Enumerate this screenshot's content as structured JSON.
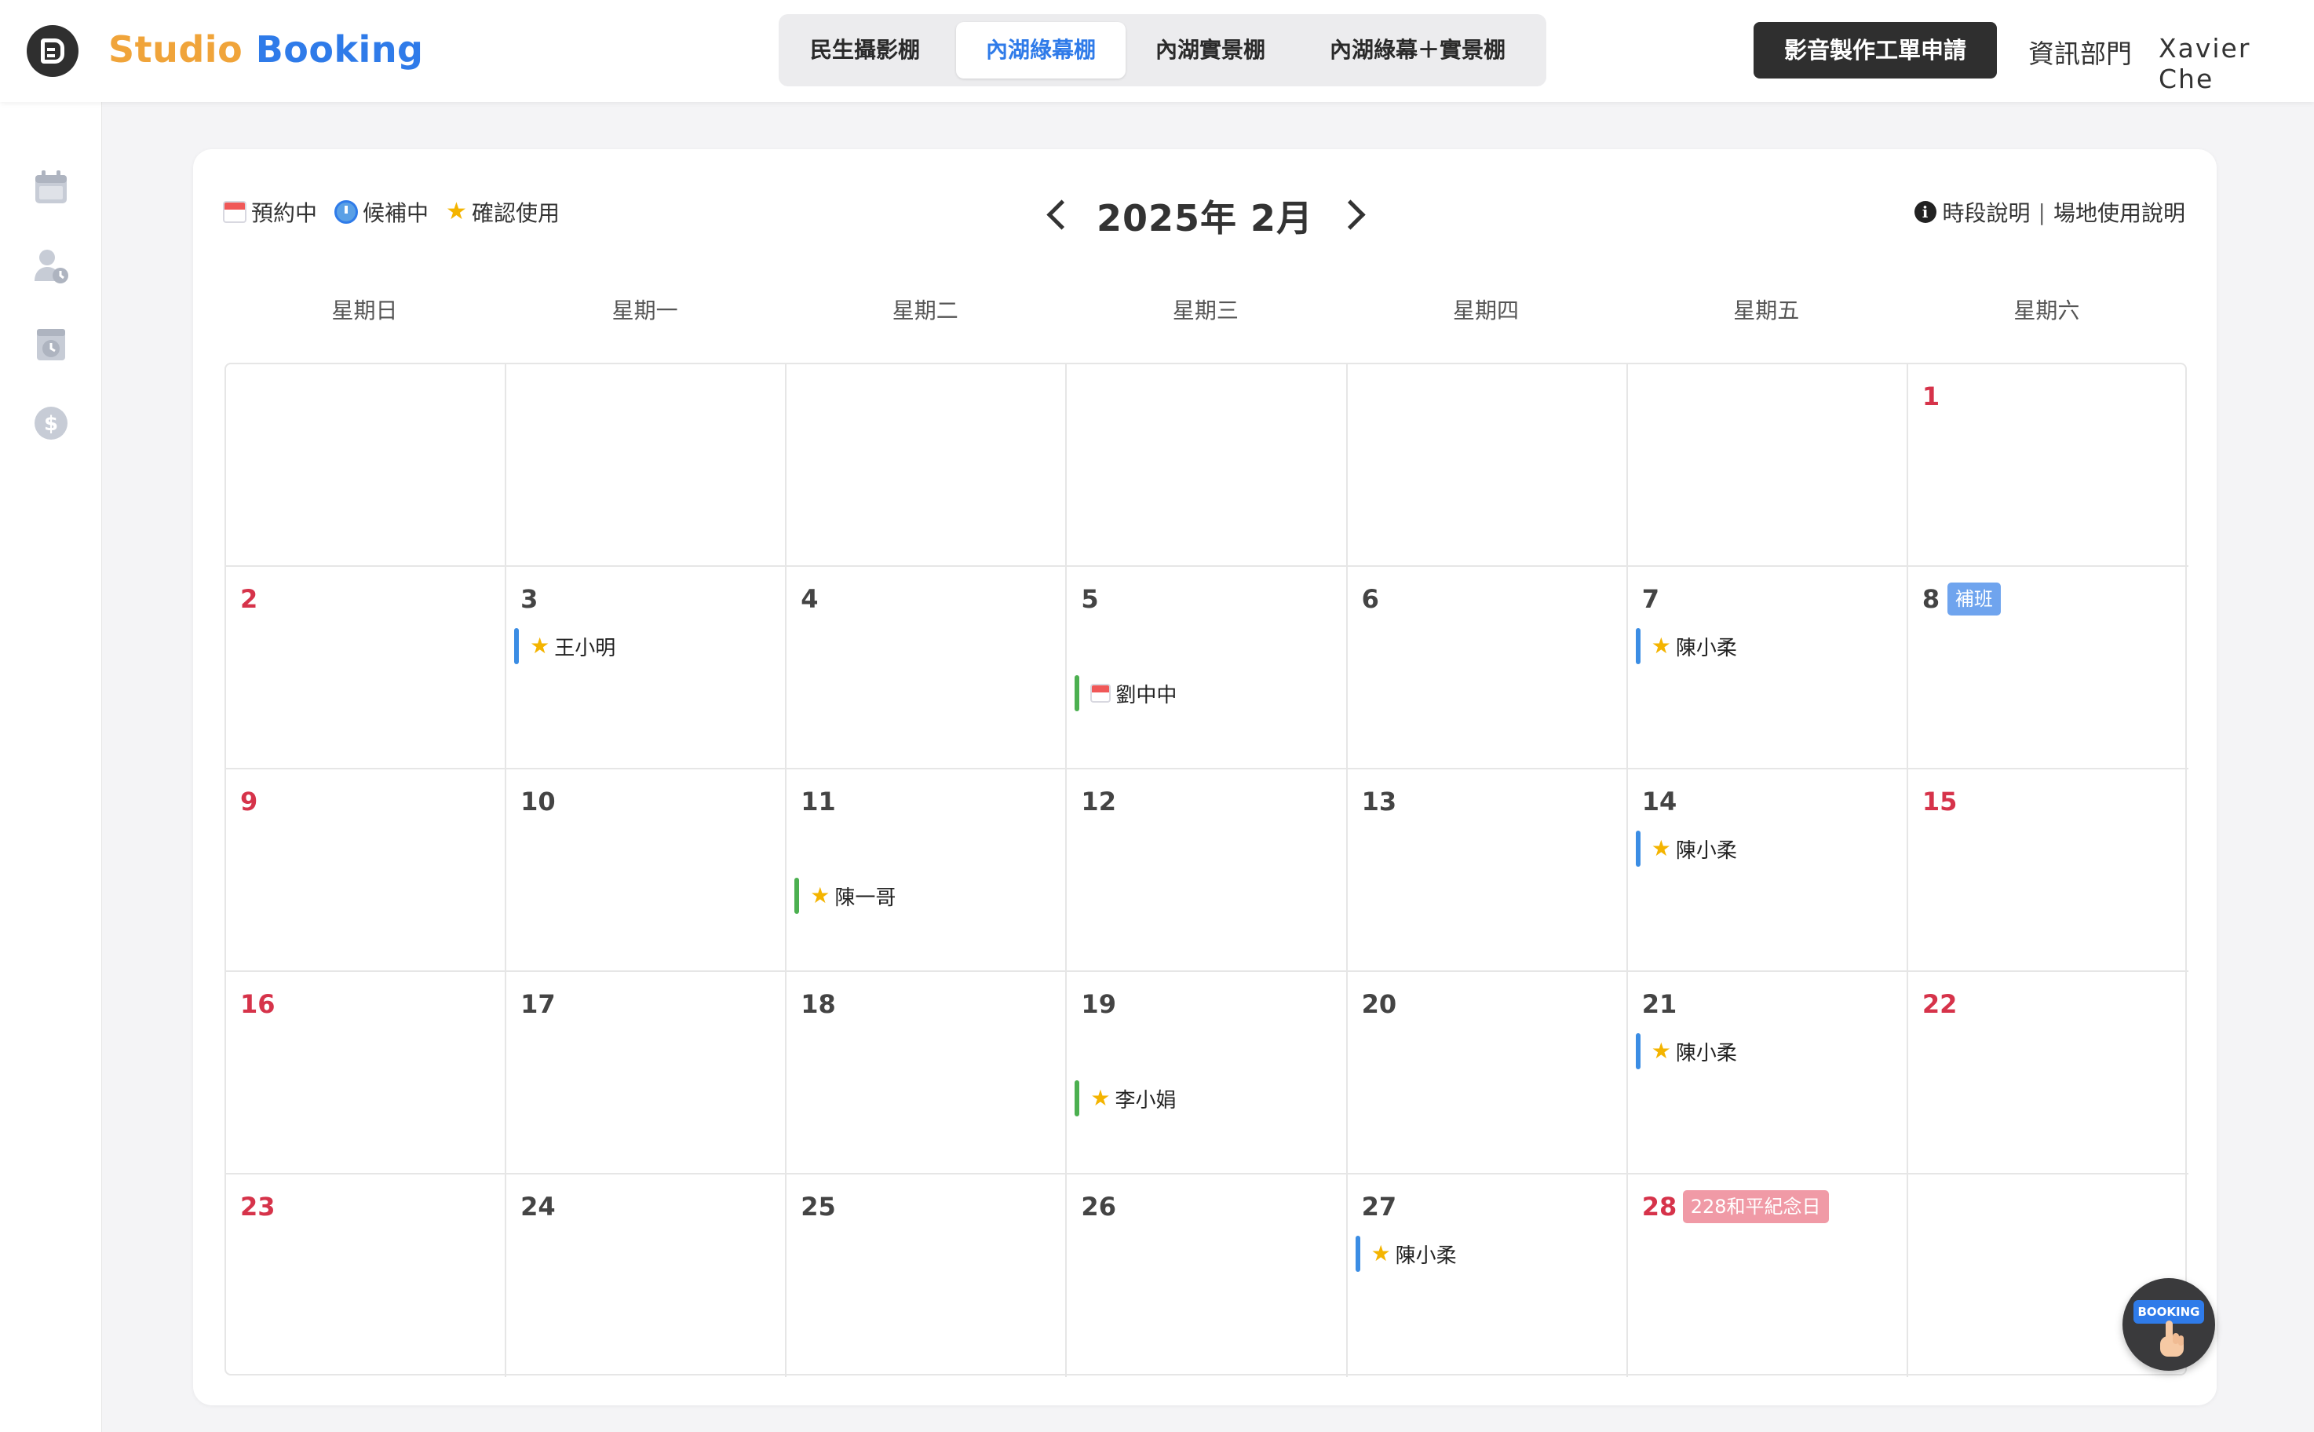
{
  "header": {
    "brand_part1": "Studio",
    "brand_part2": "Booking",
    "tabs": [
      {
        "label": "民生攝影棚",
        "active": false
      },
      {
        "label": "內湖綠幕棚",
        "active": true
      },
      {
        "label": "內湖實景棚",
        "active": false
      },
      {
        "label": "內湖綠幕＋實景棚",
        "active": false
      }
    ],
    "apply_button": "影音製作工單申請",
    "department": "資訊部門",
    "user_name": "Xavier Che"
  },
  "sidebar": {
    "icons": [
      "calendar-icon",
      "user-clock-icon",
      "booking-clock-icon",
      "dollar-icon"
    ]
  },
  "calendar": {
    "legend": [
      {
        "icon": "calendar-icon",
        "label": "預約中"
      },
      {
        "icon": "clock-icon",
        "label": "候補中"
      },
      {
        "icon": "star-icon",
        "label": "確認使用"
      }
    ],
    "month_label": "2025年 2月",
    "info_links": [
      "時段說明",
      "場地使用說明"
    ],
    "weekdays": [
      "星期日",
      "星期一",
      "星期二",
      "星期三",
      "星期四",
      "星期五",
      "星期六"
    ],
    "weeks": [
      [
        null,
        null,
        null,
        null,
        null,
        null,
        {
          "day": "1",
          "holiday": true
        }
      ],
      [
        {
          "day": "2",
          "holiday": true
        },
        {
          "day": "3"
        },
        {
          "day": "4"
        },
        {
          "day": "5"
        },
        {
          "day": "6"
        },
        {
          "day": "7"
        },
        {
          "day": "8",
          "badge": "補班",
          "badge_type": "work"
        }
      ],
      [
        {
          "day": "9",
          "holiday": true
        },
        {
          "day": "10"
        },
        {
          "day": "11"
        },
        {
          "day": "12"
        },
        {
          "day": "13"
        },
        {
          "day": "14"
        },
        {
          "day": "15",
          "holiday": true
        }
      ],
      [
        {
          "day": "16",
          "holiday": true
        },
        {
          "day": "17"
        },
        {
          "day": "18"
        },
        {
          "day": "19"
        },
        {
          "day": "20"
        },
        {
          "day": "21"
        },
        {
          "day": "22",
          "holiday": true
        }
      ],
      [
        {
          "day": "23",
          "holiday": true
        },
        {
          "day": "24"
        },
        {
          "day": "25"
        },
        {
          "day": "26"
        },
        {
          "day": "27"
        },
        {
          "day": "28",
          "holiday": true,
          "badge": "228和平紀念日",
          "badge_type": "holiday"
        },
        null
      ]
    ],
    "events": [
      {
        "day": "3",
        "name": "王小明",
        "status": "star-icon",
        "session": "blue"
      },
      {
        "day": "5",
        "name": "劉中中",
        "status": "calendar-icon",
        "session": "green"
      },
      {
        "day": "7",
        "name": "陳小柔",
        "status": "star-icon",
        "session": "blue"
      },
      {
        "day": "11",
        "name": "陳一哥",
        "status": "star-icon",
        "session": "green"
      },
      {
        "day": "14",
        "name": "陳小柔",
        "status": "star-icon",
        "session": "blue"
      },
      {
        "day": "19",
        "name": "李小娟",
        "status": "star-icon",
        "session": "green"
      },
      {
        "day": "21",
        "name": "陳小柔",
        "status": "star-icon",
        "session": "blue"
      },
      {
        "day": "27",
        "name": "陳小柔",
        "status": "star-icon",
        "session": "blue"
      }
    ]
  },
  "fab": {
    "label": "BOOKING"
  },
  "colors": {
    "brand_orange": "#f0a43a",
    "brand_blue": "#2f7be9",
    "holiday_red": "#d6334a",
    "event_blue": "#3b8de4",
    "event_green": "#4cb050",
    "workday_badge": "#6fa4ee",
    "holiday_badge": "#f09aa6"
  }
}
